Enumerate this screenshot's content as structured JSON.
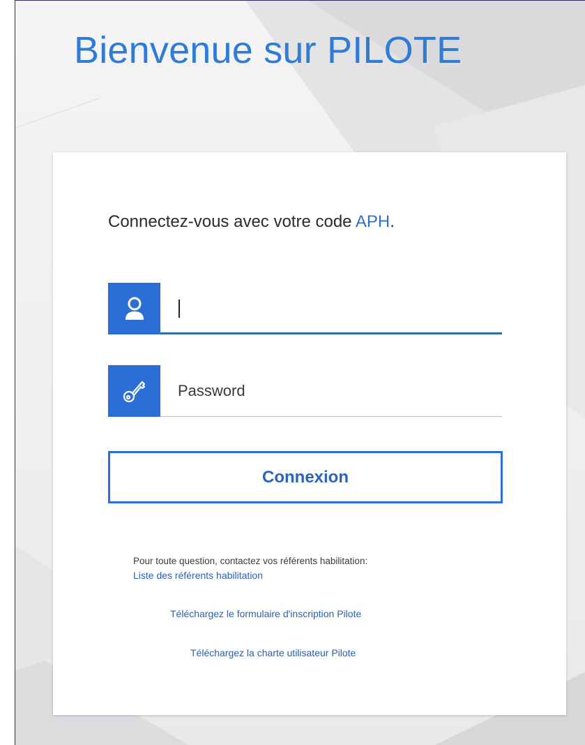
{
  "page": {
    "title": "Bienvenue sur PILOTE"
  },
  "login": {
    "subtitle_prefix": "Connectez-vous avec votre code ",
    "subtitle_accent": "APH",
    "subtitle_suffix": ".",
    "username": {
      "value": "",
      "placeholder": "",
      "icon": "user-icon"
    },
    "password": {
      "value": "",
      "placeholder": "Password",
      "icon": "key-icon"
    },
    "submit_label": "Connexion"
  },
  "help": {
    "question_text": "Pour toute question, contactez vos référents habilitation:",
    "referents_link": "Liste des référents habilitation",
    "form_link": "Téléchargez le formulaire d'inscription Pilote",
    "charter_link": "Téléchargez la charte utilisateur Pilote"
  },
  "colors": {
    "accent": "#2b6fd6",
    "title": "#2f7bd8",
    "link": "#2761b0"
  }
}
